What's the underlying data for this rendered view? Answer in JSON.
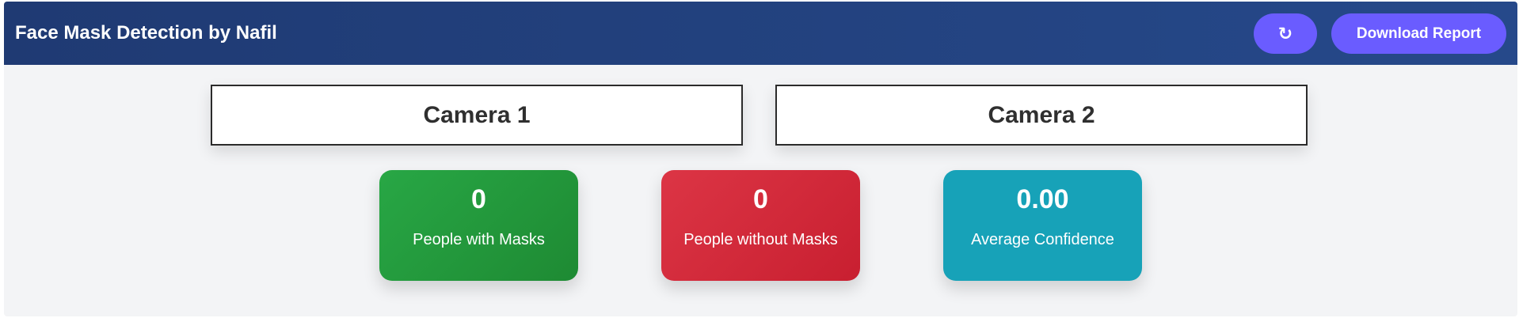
{
  "header": {
    "title": "Face Mask Detection by Nafil",
    "refresh_button": "↻",
    "refresh_icon": "refresh-icon",
    "download_button": "Download Report"
  },
  "cameras": [
    {
      "title": "Camera 1"
    },
    {
      "title": "Camera 2"
    }
  ],
  "stats": [
    {
      "value": "0",
      "label": "People with Masks",
      "color": "#28a745"
    },
    {
      "value": "0",
      "label": "People without Masks",
      "color": "#dc3545"
    },
    {
      "value": "0.00",
      "label": "Average Confidence",
      "color": "#17a2b8"
    }
  ],
  "colors": {
    "header": "#1f3a73",
    "button": "#6a5cff",
    "background": "#f3f4f6"
  }
}
